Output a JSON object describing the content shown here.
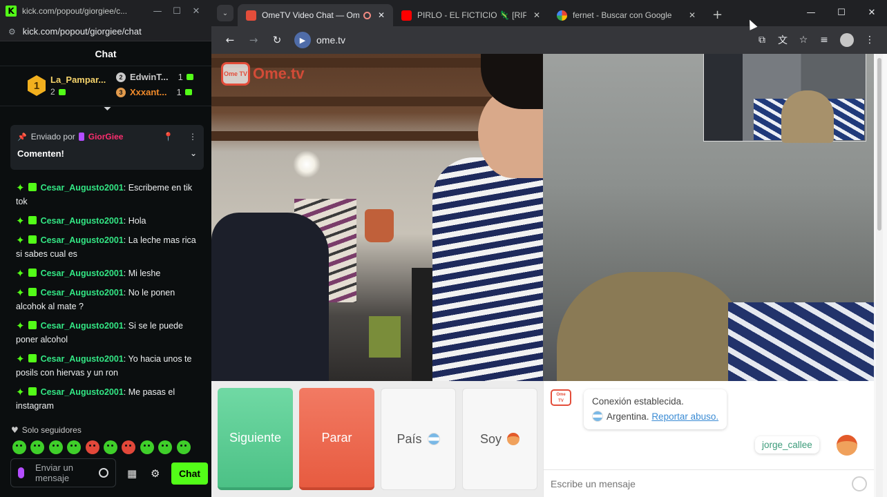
{
  "kick_window": {
    "title": "kick.com/popout/giorgiee/c...",
    "url": "kick.com/popout/giorgiee/chat",
    "chat_header": "Chat",
    "leaderboard": [
      {
        "rank": "1",
        "name": "La_Pampar...",
        "count": "2"
      },
      {
        "rank": "2",
        "name": "EdwinT...",
        "count": "1"
      },
      {
        "rank": "3",
        "name": "Xxxant...",
        "count": "1"
      }
    ],
    "pinned": {
      "sent_by_label": "Enviado por",
      "user": "GiorGiee",
      "message": "Comenten!"
    },
    "messages": [
      {
        "user": "Cesar_Augusto2001",
        "text": ": Escribeme en tik tok"
      },
      {
        "user": "Cesar_Augusto2001",
        "text": ": Hola"
      },
      {
        "user": "Cesar_Augusto2001",
        "text": ": La leche mas rica si sabes cual es"
      },
      {
        "user": "Cesar_Augusto2001",
        "text": ": Mi leshe"
      },
      {
        "user": "Cesar_Augusto2001",
        "text": ": No le ponen alcohok al mate ?"
      },
      {
        "user": "Cesar_Augusto2001",
        "text": ": Si se le puede poner alcohol"
      },
      {
        "user": "Cesar_Augusto2001",
        "text": ": Yo hacia unos te posils con hiervas y un ron"
      },
      {
        "user": "Cesar_Augusto2001",
        "text": ": Me pasas el instagram"
      }
    ],
    "followers_only": "Solo seguidores",
    "input_placeholder": "Enviar un mensaje",
    "send_label": "Chat",
    "brand_color": "#53fc18"
  },
  "browser": {
    "tabs": [
      {
        "title": "OmeTV Video Chat — Ome",
        "active": true
      },
      {
        "title": "PIRLO - EL FICTICIO 🦎 [RIP Ble",
        "active": false
      },
      {
        "title": "fernet - Buscar con Google",
        "active": false
      }
    ],
    "url": "ome.tv"
  },
  "ometv": {
    "logo_text": "Ome.tv",
    "logo_badge": "Ome TV",
    "buttons": {
      "next": "Siguiente",
      "stop": "Parar",
      "country": "País",
      "iam": "Soy"
    },
    "system_message": {
      "line1": "Conexión establecida.",
      "country": "Argentina.",
      "report": "Reportar abuso."
    },
    "peer_name": "jorge_callee",
    "message_placeholder": "Escribe un mensaje",
    "colors": {
      "next": "#4cc186",
      "stop": "#e75b40",
      "accent": "#e34d3a"
    }
  }
}
